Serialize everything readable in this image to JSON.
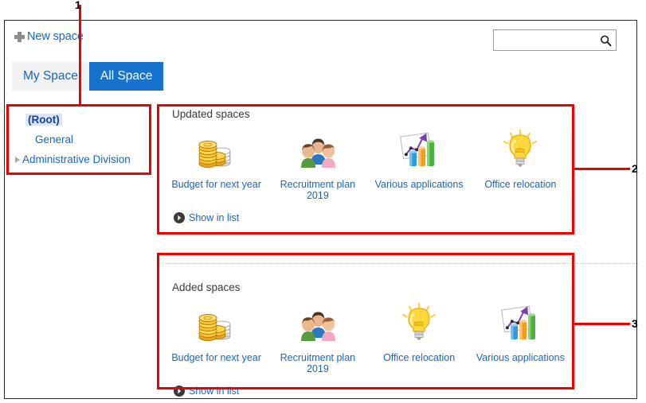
{
  "toolbar": {
    "new_space_label": "New space",
    "plus_icon": "plus-icon",
    "search_value": "",
    "search_placeholder": "",
    "search_icon": "search-icon"
  },
  "tabs": [
    {
      "label": "My Space",
      "active": false
    },
    {
      "label": "All Space",
      "active": true
    }
  ],
  "tree": {
    "nodes": [
      {
        "label": "(Root)",
        "selected": true,
        "caret": false,
        "indent": 0
      },
      {
        "label": "General",
        "selected": false,
        "caret": false,
        "indent": 1
      },
      {
        "label": "Administrative Division",
        "selected": false,
        "caret": true,
        "indent": 0
      }
    ]
  },
  "panels": [
    {
      "title": "Updated spaces",
      "show_in_list_label": "Show in list",
      "cards": [
        {
          "label": "Budget for next year",
          "icon": "coins-icon"
        },
        {
          "label": "Recruitment plan 2019",
          "icon": "people-icon"
        },
        {
          "label": "Various applications",
          "icon": "chart-icon"
        },
        {
          "label": "Office relocation",
          "icon": "lightbulb-icon"
        }
      ]
    },
    {
      "title": "Added spaces",
      "show_in_list_label": "Show in list",
      "cards": [
        {
          "label": "Budget for next year",
          "icon": "coins-icon"
        },
        {
          "label": "Recruitment plan 2019",
          "icon": "people-icon"
        },
        {
          "label": "Office relocation",
          "icon": "lightbulb-icon"
        },
        {
          "label": "Various applications",
          "icon": "chart-icon"
        }
      ]
    }
  ],
  "annotations": [
    {
      "number": "1"
    },
    {
      "number": "2"
    },
    {
      "number": "3"
    }
  ],
  "colors": {
    "link": "#1867c0",
    "active_tab_bg": "#1672cb",
    "inactive_tab_bg": "#f2f2f2",
    "selected_node_bg": "#d7e7f7",
    "annotation": "#ee0000"
  }
}
